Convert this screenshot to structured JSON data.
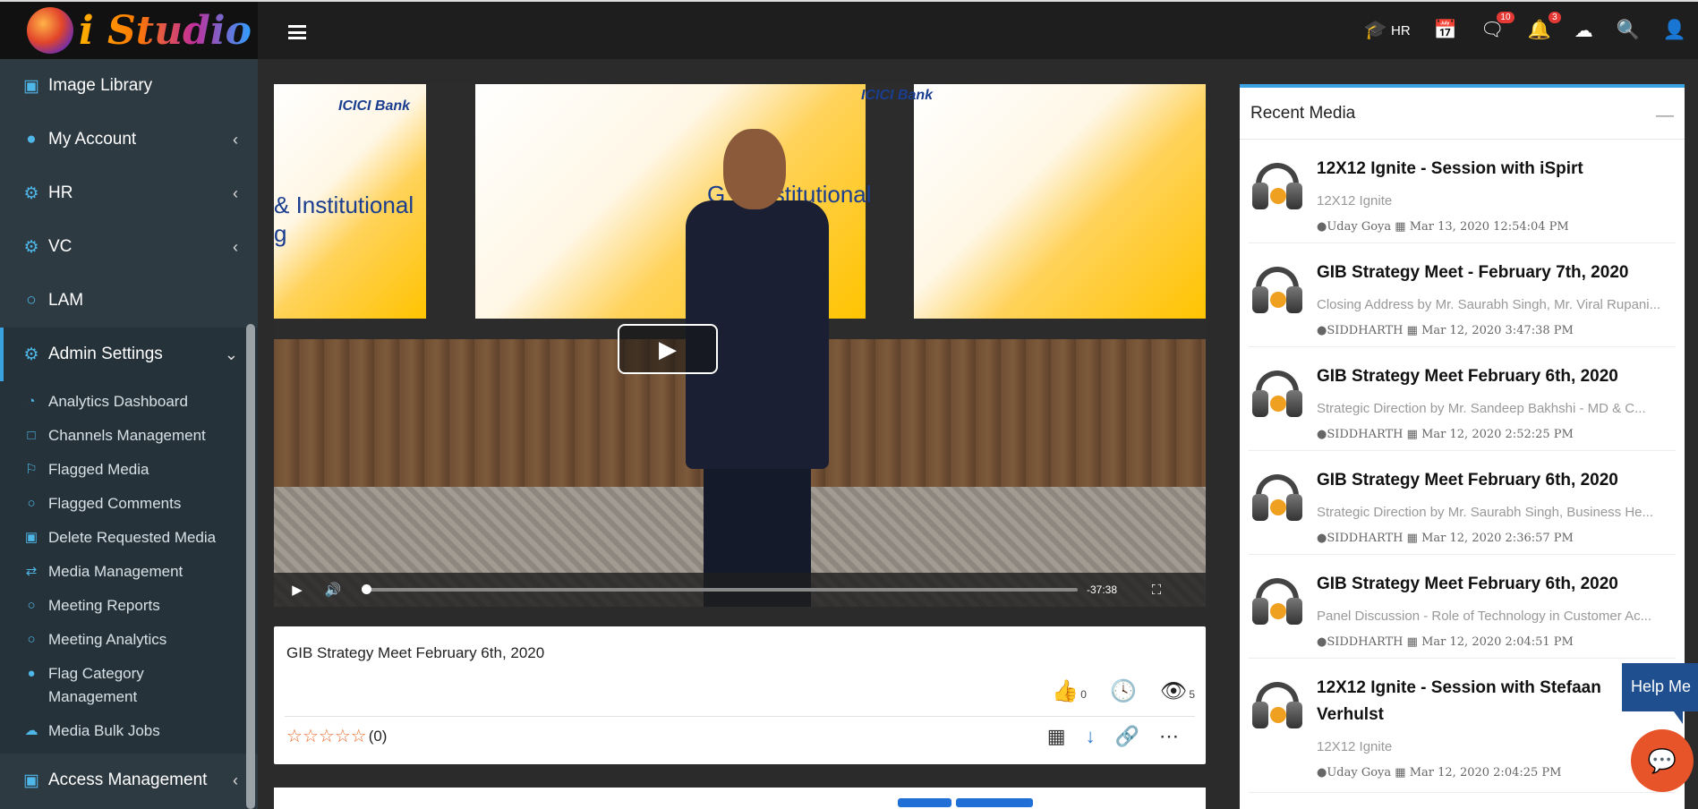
{
  "app": {
    "name": "i Studio"
  },
  "topbar": {
    "hr_label": "HR",
    "messages_badge": "10",
    "notifications_badge": "3"
  },
  "sidebar": {
    "items": [
      {
        "label": "Image Library",
        "icon": "image-icon"
      },
      {
        "label": "My Account",
        "icon": "user-icon"
      },
      {
        "label": "HR",
        "icon": "gears-icon"
      },
      {
        "label": "VC",
        "icon": "gears-icon"
      },
      {
        "label": "LAM",
        "icon": "circle-icon"
      },
      {
        "label": "Admin Settings",
        "icon": "gears-icon"
      }
    ],
    "admin_sub": [
      {
        "label": "Analytics Dashboard",
        "icon": "pie-chart-icon"
      },
      {
        "label": "Channels Management",
        "icon": "bookmark-icon"
      },
      {
        "label": "Flagged Media",
        "icon": "flag-icon"
      },
      {
        "label": "Flagged Comments",
        "icon": "comments-icon"
      },
      {
        "label": "Delete Requested Media",
        "icon": "trash-icon"
      },
      {
        "label": "Media Management",
        "icon": "shuffle-icon"
      },
      {
        "label": "Meeting Reports",
        "icon": "circle-icon"
      },
      {
        "label": "Meeting Analytics",
        "icon": "circle-icon"
      },
      {
        "label": "Flag Category Management",
        "icon": "users-icon"
      },
      {
        "label": "Media Bulk Jobs",
        "icon": "cloud-upload-icon"
      }
    ],
    "access_management": "Access Management"
  },
  "video": {
    "bank_text": "ICICI Bank",
    "screen_left_text": "& Institutional",
    "screen_left_text2": "g",
    "screen_right_text": "G  & Institutional",
    "screen_right_text2": "B   g",
    "time_remaining": "-37:38",
    "progress": 0.0
  },
  "media_info": {
    "title": "GIB Strategy Meet February 6th, 2020",
    "likes": "0",
    "views": "5",
    "rating_count": "(0)",
    "rating": 0
  },
  "recent_media": {
    "heading": "Recent Media",
    "items": [
      {
        "title": "12X12 Ignite - Session with iSpirt",
        "subtitle": "12X12 Ignite",
        "author": "Uday Goya",
        "date": "Mar 13, 2020 12:54:04 PM"
      },
      {
        "title": "GIB Strategy Meet - February 7th, 2020",
        "subtitle": "Closing Address by Mr. Saurabh Singh, Mr. Viral Rupani...",
        "author": "SIDDHARTH",
        "date": "Mar 12, 2020 3:47:38 PM"
      },
      {
        "title": "GIB Strategy Meet February 6th, 2020",
        "subtitle": "Strategic Direction by Mr. Sandeep Bakhshi - MD & C...",
        "author": "SIDDHARTH",
        "date": "Mar 12, 2020 2:52:25 PM"
      },
      {
        "title": "GIB Strategy Meet February 6th, 2020",
        "subtitle": "Strategic Direction by Mr. Saurabh Singh, Business He...",
        "author": "SIDDHARTH",
        "date": "Mar 12, 2020 2:36:57 PM"
      },
      {
        "title": "GIB Strategy Meet February 6th, 2020",
        "subtitle": "Panel Discussion - Role of Technology in Customer Ac...",
        "author": "SIDDHARTH",
        "date": "Mar 12, 2020 2:04:51 PM"
      },
      {
        "title": "12X12 Ignite - Session with Stefaan Verhulst",
        "subtitle": "12X12 Ignite",
        "author": "Uday Goya",
        "date": "Mar 12, 2020 2:04:25 PM"
      }
    ]
  },
  "help": {
    "label": "Help Me"
  }
}
